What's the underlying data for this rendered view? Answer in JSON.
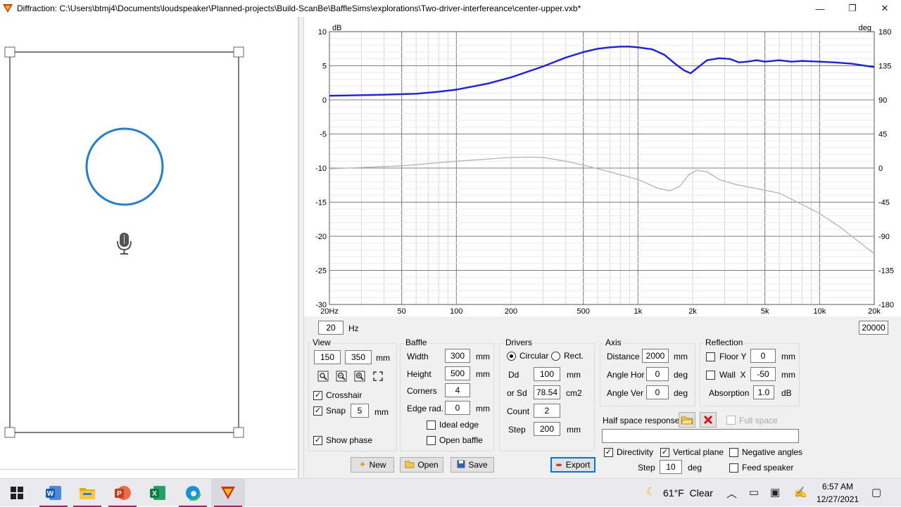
{
  "window": {
    "title": "Diffraction: C:\\Users\\btmj4\\Documents\\loudspeaker\\Planned-projects\\Build-ScanBe\\BaffleSims\\explorations\\Two-driver-interfereance\\center-upper.vxb*",
    "minimize": "—",
    "maximize": "❐",
    "close": "✕"
  },
  "graph": {
    "left_unit": "dB",
    "right_unit": "deg",
    "y_ticks": [
      "10",
      "5",
      "0",
      "-5",
      "-10",
      "-15",
      "-20",
      "-25",
      "-30"
    ],
    "phase_ticks": [
      "180",
      "135",
      "90",
      "45",
      "0",
      "-45",
      "-90",
      "-135",
      "-180"
    ],
    "x_ticks": [
      "20Hz",
      "50",
      "100",
      "200",
      "500",
      "1k",
      "2k",
      "5k",
      "10k",
      "20k"
    ],
    "freq_min": "20",
    "freq_min_unit": "Hz",
    "freq_max": "20000",
    "colors": {
      "magnitude": "#1a1aff",
      "phase": "#b4b4b4",
      "grid": "#d8d8d8",
      "grid_major": "#7f7f7f"
    }
  },
  "chart_data": {
    "type": "line",
    "xlabel": "",
    "ylabel": "dB",
    "y2label": "deg",
    "xscale": "log",
    "xlim": [
      20,
      20000
    ],
    "ylim": [
      -30,
      10
    ],
    "y2lim": [
      -180,
      180
    ],
    "grid": true,
    "series": [
      {
        "axis": "left",
        "color": "#1a1aff",
        "x": [
          20,
          40,
          60,
          80,
          100,
          150,
          200,
          300,
          400,
          500,
          600,
          700,
          800,
          900,
          1000,
          1200,
          1400,
          1600,
          1800,
          1950,
          2100,
          2400,
          2800,
          3200,
          3600,
          4000,
          4500,
          5000,
          6000,
          7000,
          8000,
          10000,
          12000,
          15000,
          20000
        ],
        "y": [
          0.6,
          0.75,
          0.9,
          1.2,
          1.5,
          2.4,
          3.3,
          4.9,
          6.2,
          7.0,
          7.5,
          7.7,
          7.8,
          7.8,
          7.7,
          7.4,
          6.6,
          5.3,
          4.3,
          3.9,
          4.6,
          5.8,
          6.1,
          6.0,
          5.5,
          5.6,
          5.8,
          5.6,
          5.8,
          5.6,
          5.7,
          5.6,
          5.5,
          5.3,
          4.8
        ]
      },
      {
        "axis": "right",
        "color": "#b4b4b4",
        "x": [
          20,
          50,
          100,
          150,
          200,
          250,
          300,
          400,
          500,
          700,
          1000,
          1300,
          1500,
          1700,
          1900,
          2100,
          2400,
          2800,
          3500,
          4500,
          6000,
          8000,
          10000,
          13000,
          16000,
          20000
        ],
        "y": [
          -1,
          3,
          9,
          12,
          14,
          14.5,
          14,
          9,
          4,
          -5,
          -15,
          -27,
          -30,
          -24,
          -9,
          -3,
          -5,
          -15,
          -22,
          -27,
          -33,
          -48,
          -60,
          -78,
          -95,
          -113
        ]
      }
    ]
  },
  "view": {
    "title": "View",
    "width": "150",
    "height": "350",
    "unit": "mm",
    "crosshair_label": "Crosshair",
    "crosshair": true,
    "snap_label": "Snap",
    "snap": true,
    "snap_value": "5",
    "snap_unit": "mm",
    "show_phase_label": "Show phase",
    "show_phase": true
  },
  "baffle": {
    "title": "Baffle",
    "width_label": "Width",
    "width": "300",
    "height_label": "Height",
    "height": "500",
    "corners_label": "Corners",
    "corners": "4",
    "edge_rad_label": "Edge rad.",
    "edge_rad": "0",
    "unit": "mm",
    "ideal_edge_label": "Ideal edge",
    "open_baffle_label": "Open baffle"
  },
  "drivers": {
    "title": "Drivers",
    "circular_label": "Circular",
    "rect_label": "Rect.",
    "dd_label": "Dd",
    "dd": "100",
    "dd_unit": "mm",
    "sd_label": "or Sd",
    "sd": "78.54",
    "sd_unit": "cm2",
    "count_label": "Count",
    "count": "2",
    "step_label": "Step",
    "step": "200",
    "step_unit": "mm"
  },
  "axis": {
    "title": "Axis",
    "distance_label": "Distance",
    "distance": "2000",
    "distance_unit": "mm",
    "angle_hor_label": "Angle Hor",
    "angle_hor": "0",
    "angle_ver_label": "Angle Ver",
    "angle_ver": "0",
    "deg": "deg"
  },
  "reflection": {
    "title": "Reflection",
    "floor_label": "Floor Y",
    "floor": "0",
    "wall_label": "Wall  X",
    "wall": "-50",
    "unit": "mm",
    "absorption_label": "Absorption",
    "absorption": "1.0",
    "absorption_unit": "dB"
  },
  "halfspace": {
    "label": "Half space response",
    "full_space_label": "Full space"
  },
  "options": {
    "directivity_label": "Directivity",
    "vertical_plane_label": "Vertical plane",
    "negative_angles_label": "Negative angles",
    "step_label": "Step",
    "step": "10",
    "step_unit": "deg",
    "feed_speaker_label": "Feed speaker"
  },
  "buttons": {
    "new": "New",
    "open": "Open",
    "save": "Save",
    "export": "Export"
  },
  "taskbar": {
    "weather": "61°F  Clear",
    "time": "6:57 AM",
    "date": "12/27/2021"
  }
}
